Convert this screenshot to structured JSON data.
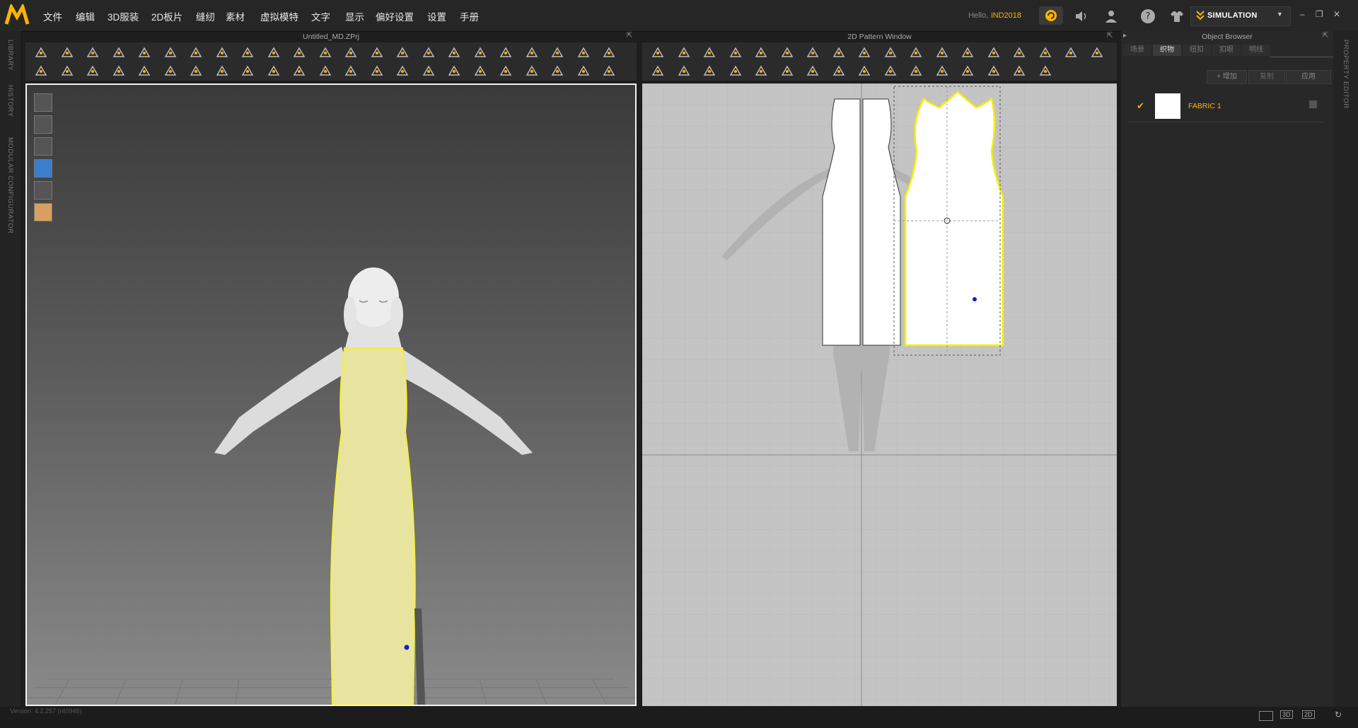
{
  "menu": {
    "items": [
      "文件",
      "编辑",
      "3D服装",
      "2D板片",
      "缝纫",
      "素材",
      "虚拟模特",
      "文字",
      "显示",
      "偏好设置",
      "设置",
      "手册"
    ]
  },
  "user": {
    "hello": "Hello,",
    "name": "iND2018"
  },
  "simulation": {
    "label": "SIMULATION"
  },
  "left_strip": {
    "library": "LIBRARY",
    "history": "HISTORY",
    "modular": "MODULAR CONFIGURATOR"
  },
  "right_strip": {
    "property": "PROPERTY EDITOR"
  },
  "view3d": {
    "title": "Untitled_MD.ZPrj"
  },
  "view2d": {
    "title": "2D Pattern Window"
  },
  "object_browser": {
    "title": "Object Browser",
    "tabs": [
      "场景",
      "织物",
      "纽扣",
      "扣眼",
      "明线"
    ],
    "actions": {
      "add": "+ 增加",
      "copy": "复制",
      "apply": "应用"
    },
    "fabric": {
      "name": "FABRIC 1"
    }
  },
  "status": {
    "version": "Version: 4.2.257 (r40946)",
    "view_3d": "3D",
    "view_2d": "2D"
  },
  "colors": {
    "accent": "#ffb400",
    "garment": "#e8e4a0",
    "selection": "#ffee00"
  },
  "icons": {
    "logo": "md-logo-icon",
    "cloud": "cloud-icon",
    "sound": "sound-icon",
    "user": "user-icon",
    "help": "help-icon",
    "shirt": "shirt-icon"
  }
}
